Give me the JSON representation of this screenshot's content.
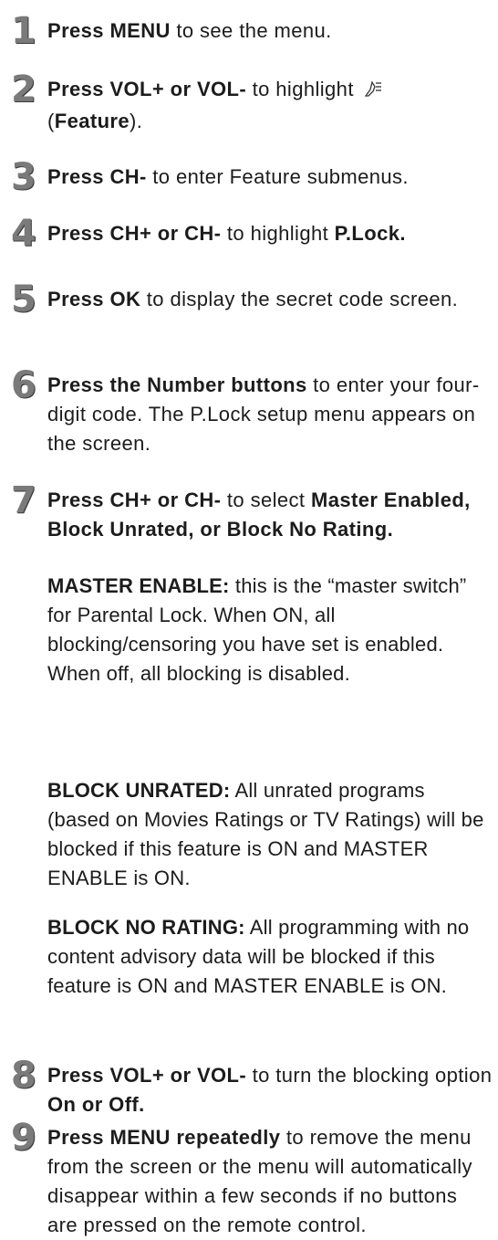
{
  "steps": [
    {
      "num": "1",
      "b1": "Press MENU",
      "t1": " to see the menu."
    },
    {
      "num": "2",
      "b1": "Press VOL+ or VOL-",
      "t1": " to highlight ",
      "icon": "feature-icon",
      "t2": "(",
      "b2": "Feature",
      "t3": ")."
    },
    {
      "num": "3",
      "b1": "Press CH-",
      "t1": " to enter Feature submenus."
    },
    {
      "num": "4",
      "b1": "Press CH+ or CH-",
      "t1": " to highlight ",
      "b2": "P.Lock."
    },
    {
      "num": "5",
      "b1": "Press OK",
      "t1": " to display the secret code screen."
    },
    {
      "num": "6",
      "b1": "Press the Number buttons",
      "t1": " to enter your four-digit code. The P.Lock setup menu appears on the screen."
    },
    {
      "num": "7",
      "b1": "Press CH+ or CH-",
      "t1": " to select ",
      "b2": "Master Enabled, Block Unrated, or Block No Rating."
    },
    {
      "num": "8",
      "b1": "Press VOL+ or VOL-",
      "t1": " to turn the blocking option ",
      "b2": "On or Off."
    },
    {
      "num": "9",
      "b1": "Press MENU repeatedly",
      "t1": " to remove the menu from the screen or the menu will automatically disappear within a few seconds if no buttons are pressed on the remote control."
    }
  ],
  "options": [
    {
      "label": "MASTER ENABLE:",
      "text": " this is the “master switch” for Parental Lock. When ON, all blocking/censoring you have set is enabled. When off, all blocking is disabled."
    },
    {
      "label": "BLOCK UNRATED:",
      "text": " All unrated programs (based on Movies Ratings or TV Ratings) will be blocked if this feature is ON and MASTER ENABLE is ON."
    },
    {
      "label": "BLOCK NO RATING:",
      "text": " All programming with no content advisory data will be blocked if this feature is ON and MASTER ENABLE is ON."
    }
  ]
}
